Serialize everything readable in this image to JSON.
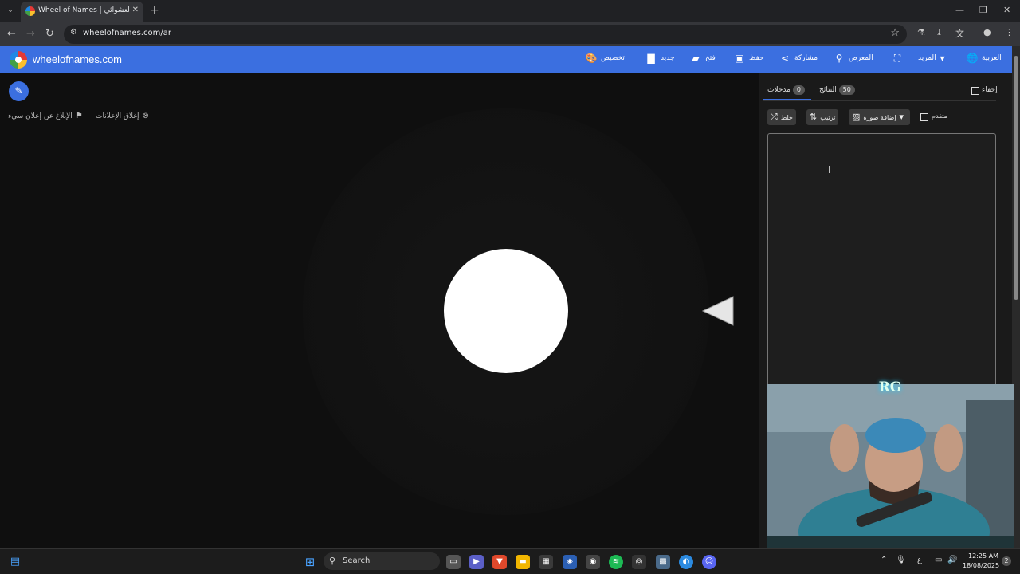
{
  "browser": {
    "tab_title": "Wheel of Names | عجلة الاسم العشوائي",
    "url": "wheelofnames.com/ar"
  },
  "header": {
    "site_name": "wheelofnames.com",
    "menu": {
      "language": "العربية",
      "more": "المزيد",
      "gallery": "المعرض",
      "share": "مشاركة",
      "save": "حفظ",
      "open": "فتح",
      "new": "جديد",
      "customize": "تخصيص"
    }
  },
  "left": {
    "report_ad": "الإبلاغ عن إعلان سيء",
    "close_ads": "إغلاق الإعلانات"
  },
  "panel": {
    "hide_label": "إخفاء",
    "tab_results_label": "النتائج",
    "tab_results_count": "50",
    "tab_entries_label": "مدخلات",
    "tab_entries_count": "0",
    "shuffle": "خلط",
    "sort": "ترتيب",
    "add_image": "إضافة صورة",
    "advanced": "متقدم"
  },
  "webcam": {
    "overlay_logo": "RG"
  },
  "taskbar": {
    "search": "Search",
    "time": "12:25 AM",
    "date": "18/08/2025",
    "lang": "ع",
    "notifications": "2"
  },
  "colors": {
    "brand_blue": "#3b6fe0",
    "background": "#0f0f0f",
    "panel": "#1a1a1a"
  }
}
